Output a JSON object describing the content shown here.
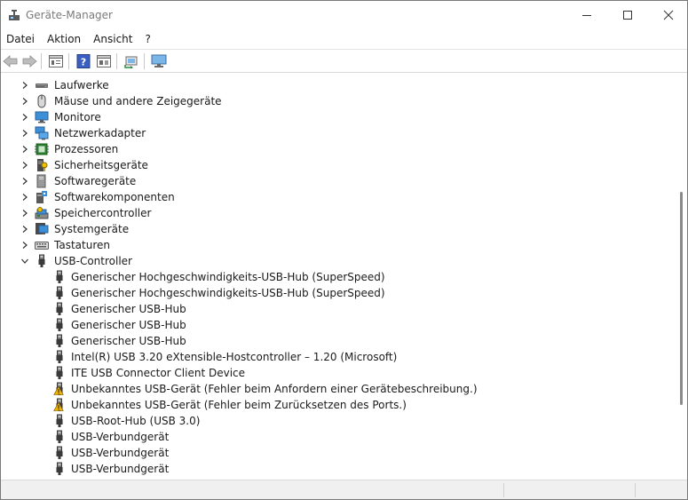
{
  "window": {
    "title": "Geräte-Manager"
  },
  "menu": [
    "Datei",
    "Aktion",
    "Ansicht",
    "?"
  ],
  "toolbar": {
    "buttons": [
      "back-icon",
      "forward-icon",
      "properties-view-icon",
      "help-icon",
      "update-driver-icon",
      "scan-hardware-icon",
      "monitor-icon"
    ]
  },
  "tree": {
    "categories": [
      {
        "label": "Laufwerke",
        "icon": "drive-icon",
        "expanded": false
      },
      {
        "label": "Mäuse und andere Zeigegeräte",
        "icon": "mouse-icon",
        "expanded": false
      },
      {
        "label": "Monitore",
        "icon": "monitor-icon",
        "expanded": false
      },
      {
        "label": "Netzwerkadapter",
        "icon": "network-icon",
        "expanded": false
      },
      {
        "label": "Prozessoren",
        "icon": "cpu-icon",
        "expanded": false
      },
      {
        "label": "Sicherheitsgeräte",
        "icon": "security-icon",
        "expanded": false
      },
      {
        "label": "Softwaregeräte",
        "icon": "software-device-icon",
        "expanded": false
      },
      {
        "label": "Softwarekomponenten",
        "icon": "software-component-icon",
        "expanded": false
      },
      {
        "label": "Speichercontroller",
        "icon": "storage-icon",
        "expanded": false
      },
      {
        "label": "Systemgeräte",
        "icon": "system-icon",
        "expanded": false
      },
      {
        "label": "Tastaturen",
        "icon": "keyboard-icon",
        "expanded": false
      },
      {
        "label": "USB-Controller",
        "icon": "usb-icon",
        "expanded": true
      }
    ],
    "usb_children": [
      {
        "label": "Generischer Hochgeschwindigkeits-USB-Hub (SuperSpeed)",
        "warning": false
      },
      {
        "label": "Generischer Hochgeschwindigkeits-USB-Hub (SuperSpeed)",
        "warning": false
      },
      {
        "label": "Generischer USB-Hub",
        "warning": false
      },
      {
        "label": "Generischer USB-Hub",
        "warning": false
      },
      {
        "label": "Generischer USB-Hub",
        "warning": false
      },
      {
        "label": "Intel(R) USB 3.20 eXtensible-Hostcontroller – 1.20 (Microsoft)",
        "warning": false
      },
      {
        "label": "ITE USB Connector Client Device",
        "warning": false
      },
      {
        "label": "Unbekanntes USB-Gerät (Fehler beim Anfordern einer Gerätebeschreibung.)",
        "warning": true
      },
      {
        "label": "Unbekanntes USB-Gerät (Fehler beim Zurücksetzen des Ports.)",
        "warning": true
      },
      {
        "label": "USB-Root-Hub (USB 3.0)",
        "warning": false
      },
      {
        "label": "USB-Verbundgerät",
        "warning": false
      },
      {
        "label": "USB-Verbundgerät",
        "warning": false
      },
      {
        "label": "USB-Verbundgerät",
        "warning": false
      }
    ]
  },
  "colors": {
    "accent": "#1e66c8",
    "warning": "#f0b400"
  }
}
